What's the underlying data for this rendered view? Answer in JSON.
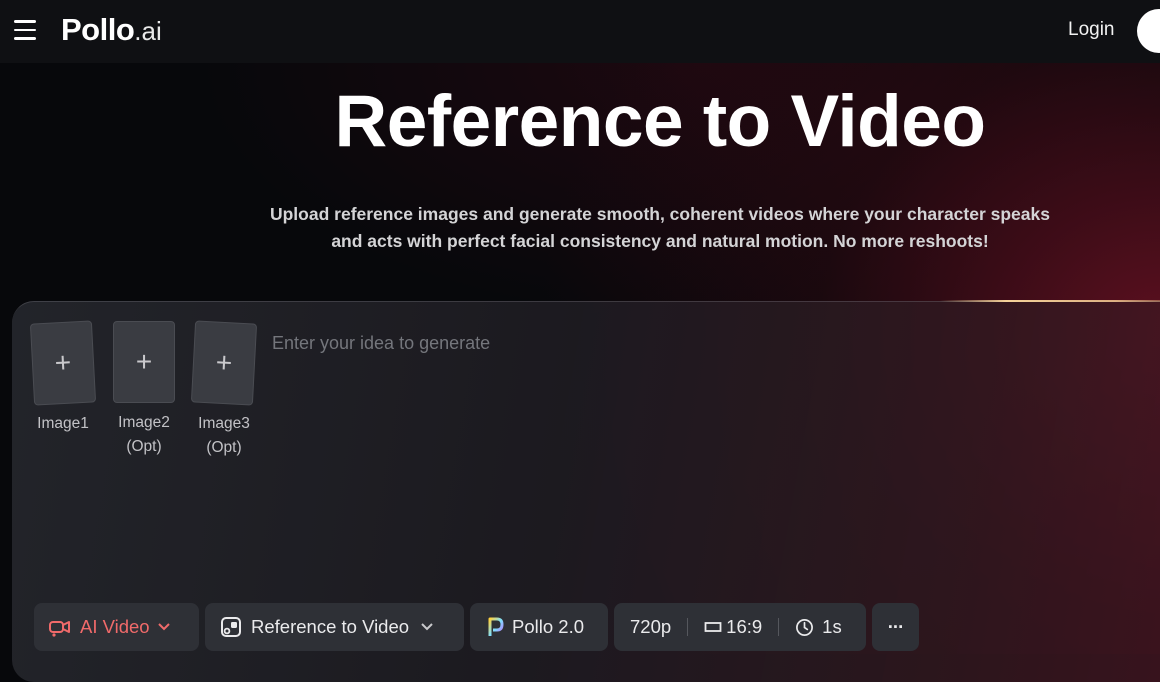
{
  "header": {
    "logo_main": "Pollo",
    "logo_sub": ".ai",
    "login_label": "Login"
  },
  "hero": {
    "title": "Reference to Video",
    "subtitle_line1": "Upload reference images and generate smooth, coherent videos where your character speaks",
    "subtitle_line2": "and acts with perfect facial consistency and natural motion. No more reshoots!"
  },
  "uploads": [
    {
      "label": "Image1",
      "sublabel": ""
    },
    {
      "label": "Image2",
      "sublabel": "(Opt)"
    },
    {
      "label": "Image3",
      "sublabel": "(Opt)"
    }
  ],
  "prompt": {
    "placeholder": "Enter your idea to generate"
  },
  "toolbar": {
    "mode_label": "AI Video",
    "type_label": "Reference to Video",
    "model_label": "Pollo 2.0",
    "resolution": "720p",
    "aspect_ratio": "16:9",
    "duration": "1s",
    "more_label": "···"
  },
  "colors": {
    "accent": "#f06a6a",
    "background": "#07080b",
    "panel": "#2e3036"
  }
}
